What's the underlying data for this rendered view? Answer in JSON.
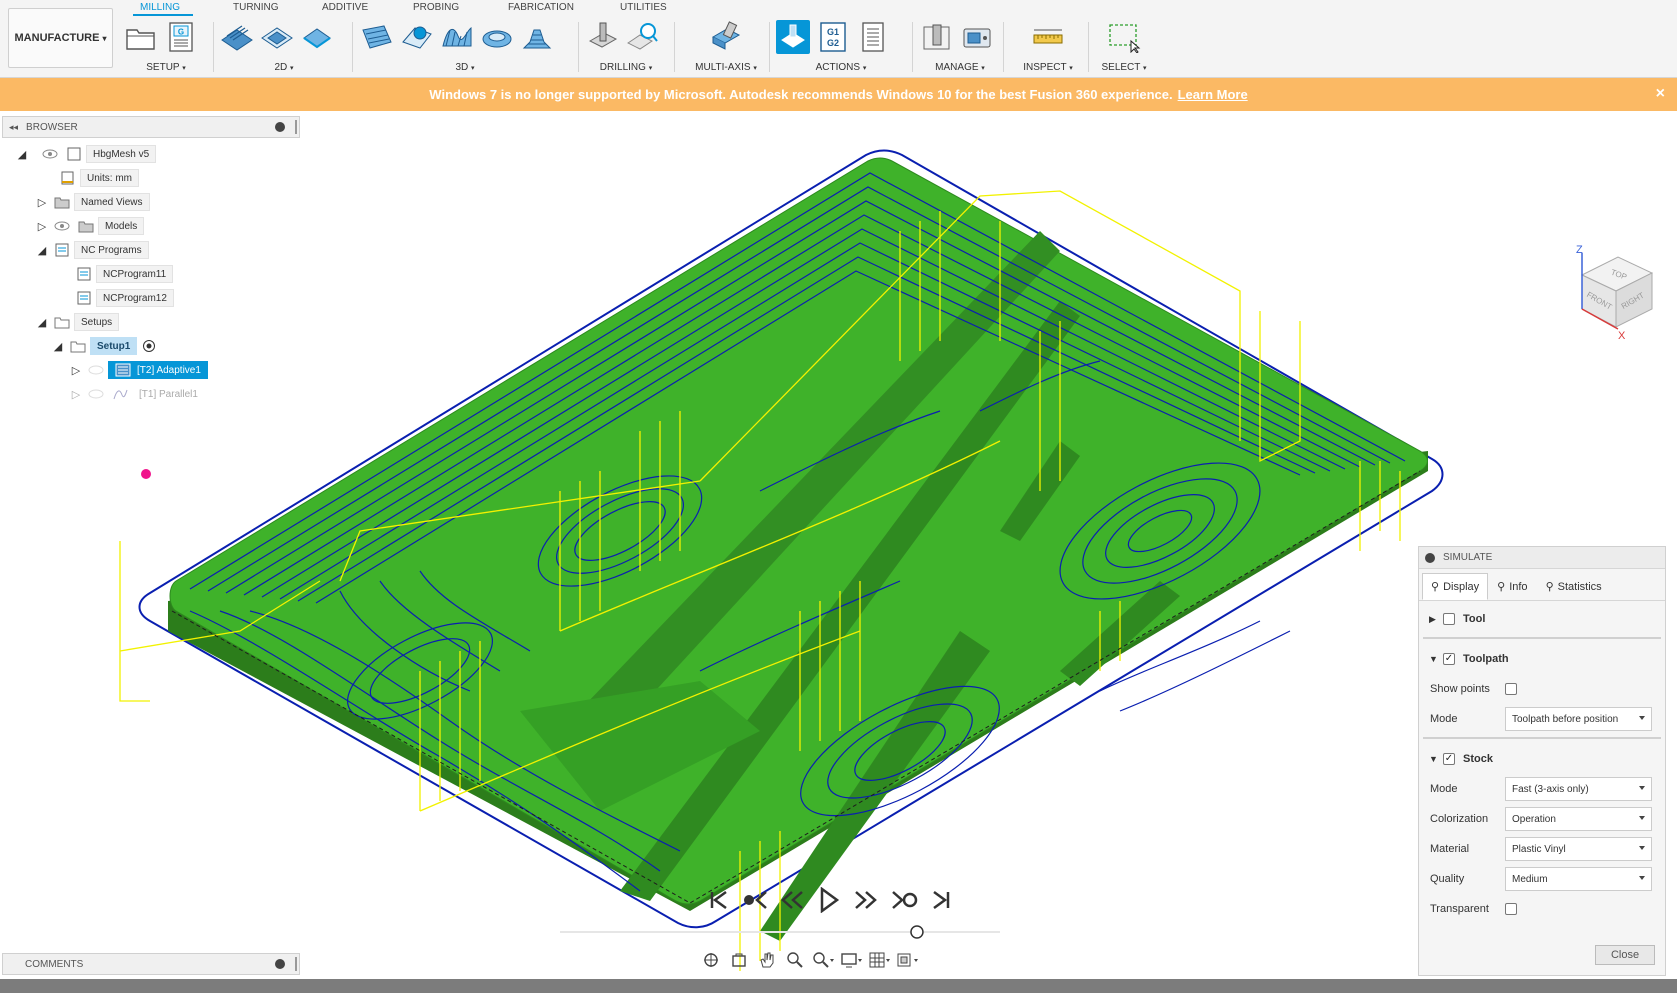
{
  "toolbar": {
    "workspace": "MANUFACTURE",
    "tabs": [
      "MILLING",
      "TURNING",
      "ADDITIVE",
      "PROBING",
      "FABRICATION",
      "UTILITIES"
    ],
    "active_tab": "MILLING",
    "groups": {
      "setup": "SETUP",
      "twod": "2D",
      "threed": "3D",
      "drilling": "DRILLING",
      "multiaxis": "MULTI-AXIS",
      "actions": "ACTIONS",
      "manage": "MANAGE",
      "inspect": "INSPECT",
      "select": "SELECT"
    },
    "gcode_icon_text": "G1 G2",
    "nc_icon_text": "G",
    "accent": "#0696d7"
  },
  "banner": {
    "message": "Windows 7 is no longer supported by Microsoft. Autodesk recommends Windows 10 for the best Fusion 360 experience.",
    "link": "Learn More",
    "close": "×",
    "color": "#fbb964"
  },
  "browser": {
    "title": "BROWSER",
    "items": {
      "root": "HbgMesh v5",
      "units": "Units: mm",
      "named_views": "Named Views",
      "models": "Models",
      "nc_programs": "NC Programs",
      "nc1": "NCProgram11",
      "nc2": "NCProgram12",
      "setups": "Setups",
      "setup1": "Setup1",
      "op1": "[T2] Adaptive1",
      "op2": "[T1] Parallel1"
    }
  },
  "comments": {
    "title": "COMMENTS"
  },
  "viewcube": {
    "top": "TOP",
    "front": "FRONT",
    "right": "RIGHT",
    "z": "Z",
    "x": "X"
  },
  "simulate": {
    "title": "SIMULATE",
    "tabs": [
      "Display",
      "Info",
      "Statistics"
    ],
    "active_tab": "Display",
    "tool": {
      "label": "Tool",
      "checked": false
    },
    "toolpath": {
      "label": "Toolpath",
      "checked": true,
      "show_points_label": "Show points",
      "show_points": false,
      "mode_label": "Mode",
      "mode": "Toolpath before position"
    },
    "stock": {
      "label": "Stock",
      "checked": true,
      "mode_label": "Mode",
      "mode": "Fast (3-axis only)",
      "colorization_label": "Colorization",
      "colorization": "Operation",
      "material_label": "Material",
      "material": "Plastic Vinyl",
      "quality_label": "Quality",
      "quality": "Medium",
      "transparent_label": "Transparent",
      "transparent": false
    },
    "close": "Close"
  },
  "playback": {
    "position": 0.82
  },
  "scene_colors": {
    "stock": "#3fb22a",
    "toolpath": "#0a1fb0",
    "rapids": "#f2f200"
  }
}
